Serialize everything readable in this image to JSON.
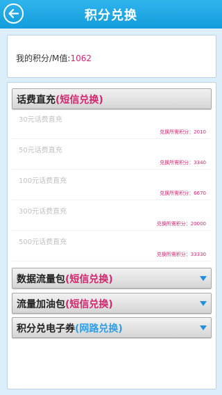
{
  "header": {
    "title": "积分兑换"
  },
  "points": {
    "label": "我的积分/M值:",
    "value": "1062"
  },
  "sections": [
    {
      "title": "话费直充",
      "tag": "(短信兑换)",
      "tag_color": "#d6246e",
      "expanded": true
    },
    {
      "title": "数据流量包",
      "tag": "(短信兑换)",
      "tag_color": "#d6246e",
      "expanded": false
    },
    {
      "title": "流量加油包",
      "tag": "(短信兑换)",
      "tag_color": "#d6246e",
      "expanded": false
    },
    {
      "title": "积分兑电子券",
      "tag": "(网路兑换)",
      "tag_color": "#2e9fe6",
      "expanded": false
    }
  ],
  "items": [
    {
      "name": "30元话费直充",
      "cost": "兑换所需积分：2010"
    },
    {
      "name": "50元话费直充",
      "cost": "兑换所需积分：3340"
    },
    {
      "name": "100元话费直充",
      "cost": "兑换所需积分：6670"
    },
    {
      "name": "300元话费直充",
      "cost": "兑换所需积分：20000"
    },
    {
      "name": "500元话费直充",
      "cost": "兑换所需积分：33330"
    }
  ]
}
